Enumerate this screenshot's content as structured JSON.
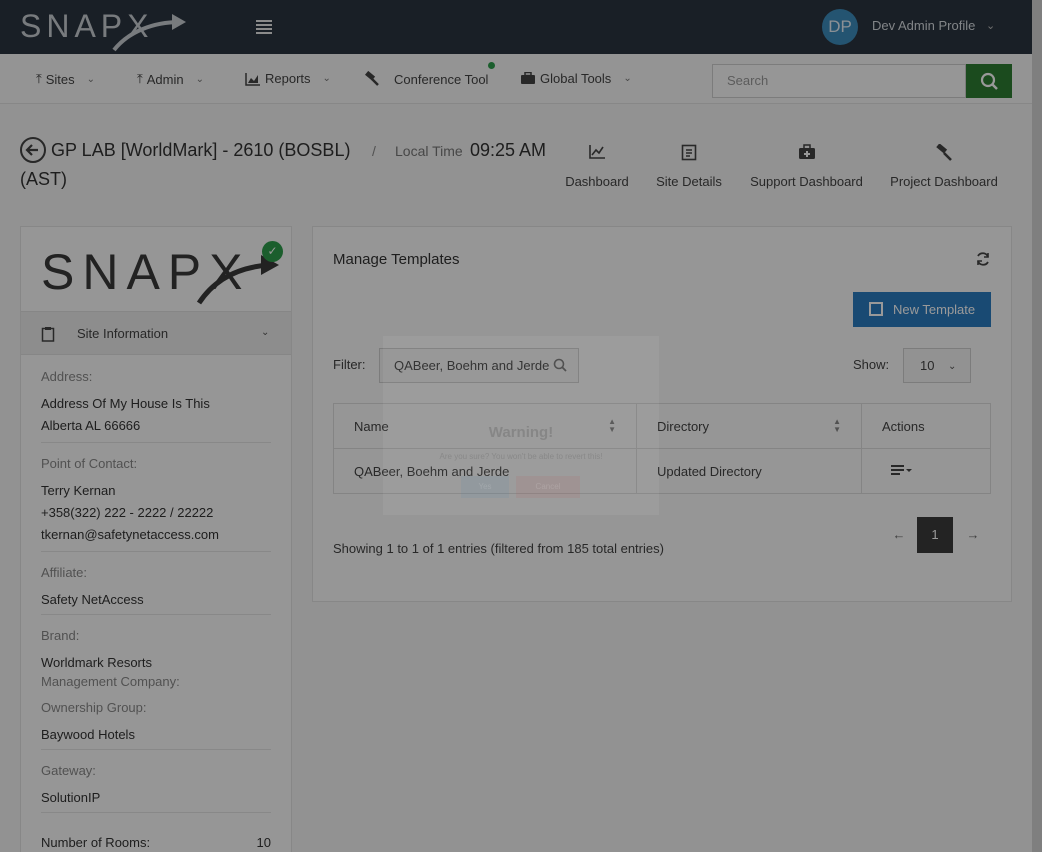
{
  "app": {
    "logo_text": "SNAPX"
  },
  "profile": {
    "initials": "DP",
    "name": "Dev Admin Profile"
  },
  "nav": {
    "items": [
      {
        "label": "Sites"
      },
      {
        "label": "Admin"
      },
      {
        "label": "Reports"
      },
      {
        "label": "Conference Tool"
      },
      {
        "label": "Global Tools"
      }
    ],
    "search_placeholder": "Search"
  },
  "site": {
    "title_line1": "GP LAB [WorldMark] - 2610 (BOSBL)",
    "title_line2": "(AST)",
    "separator": "/",
    "local_time_label": "Local Time",
    "local_time_value": "09:25 AM"
  },
  "quick_nav": [
    {
      "label": "Dashboard"
    },
    {
      "label": "Site Details"
    },
    {
      "label": "Support Dashboard"
    },
    {
      "label": "Project Dashboard"
    }
  ],
  "site_info": {
    "header": "Site Information",
    "address_label": "Address:",
    "address_line1": "Address Of My House Is This",
    "address_line2": "Alberta AL 66666",
    "contact_label": "Point of Contact:",
    "contact_name": "Terry Kernan",
    "contact_phone": "+358(322) 222 - 2222 / 22222",
    "contact_email": "tkernan@safetynetaccess.com",
    "affiliate_label": "Affiliate:",
    "affiliate_value": "Safety NetAccess",
    "brand_label": "Brand:",
    "brand_value": "Worldmark Resorts",
    "mgmt_label": "Management Company:",
    "ownership_label": "Ownership Group:",
    "ownership_value": "Baywood Hotels",
    "gateway_label": "Gateway:",
    "gateway_value": "SolutionIP",
    "rooms_label": "Number of Rooms:",
    "rooms_value": "10"
  },
  "templates": {
    "title": "Manage Templates",
    "new_button": "New Template",
    "filter_label": "Filter:",
    "filter_value": "QABeer, Boehm and Jerde",
    "show_label": "Show:",
    "show_value": "10",
    "columns": [
      "Name",
      "Directory",
      "Actions"
    ],
    "rows": [
      {
        "name": "QABeer, Boehm and Jerde",
        "directory": "Updated Directory"
      }
    ],
    "showing_text": "Showing 1 to 1 of 1 entries (filtered from 185 total entries)",
    "pager": {
      "prev": "←",
      "current": "1",
      "next": "→"
    }
  },
  "modal": {
    "title": "Warning!",
    "text": "Are you sure? You won't be able to revert this!",
    "confirm": "Yes",
    "cancel": "Cancel"
  },
  "colors": {
    "topbar": "#2b3540",
    "primary": "#2b7cc0",
    "success": "#2e9d4b",
    "search_button": "#2e7d32"
  }
}
